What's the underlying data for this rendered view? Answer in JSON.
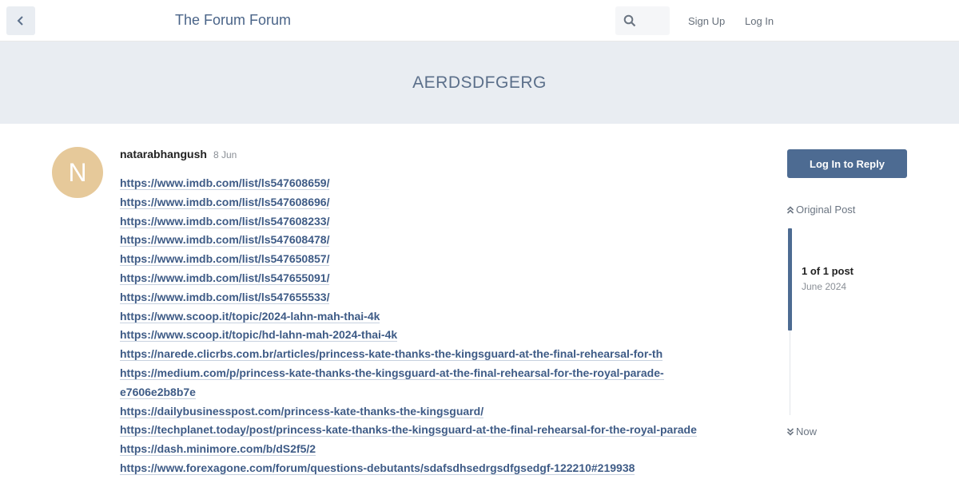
{
  "header": {
    "site_title": "The Forum Forum",
    "sign_up": "Sign Up",
    "log_in": "Log In",
    "back_icon": "chevron-left-icon",
    "search_icon": "search-icon"
  },
  "topic": {
    "title": "AERDSDFGERG"
  },
  "post": {
    "avatar_letter": "N",
    "avatar_color": "#e6c99a",
    "username": "natarabhangush",
    "date": "8 Jun",
    "links": [
      "https://www.imdb.com/list/ls547608659/",
      "https://www.imdb.com/list/ls547608696/",
      "https://www.imdb.com/list/ls547608233/",
      "https://www.imdb.com/list/ls547608478/",
      "https://www.imdb.com/list/ls547650857/",
      "https://www.imdb.com/list/ls547655091/",
      "https://www.imdb.com/list/ls547655533/",
      "https://www.scoop.it/topic/2024-lahn-mah-thai-4k",
      "https://www.scoop.it/topic/hd-lahn-mah-2024-thai-4k",
      "https://narede.clicrbs.com.br/articles/princess-kate-thanks-the-kingsguard-at-the-final-rehearsal-for-th",
      "https://medium.com/p/princess-kate-thanks-the-kingsguard-at-the-final-rehearsal-for-the-royal-parade-e7606e2b8b7e",
      "https://dailybusinesspost.com/princess-kate-thanks-the-kingsguard/",
      "https://techplanet.today/post/princess-kate-thanks-the-kingsguard-at-the-final-rehearsal-for-the-royal-parade",
      "https://dash.minimore.com/b/dS2f5/2",
      "https://www.forexagone.com/forum/questions-debutants/sdafsdhsedrgsdfgsedgf-122210#219938"
    ]
  },
  "sidebar": {
    "reply_button": "Log In to Reply",
    "original_post": "Original Post",
    "post_count": "1 of 1 post",
    "month": "June 2024",
    "now": "Now"
  },
  "colors": {
    "accent": "#4d6b92",
    "banner_bg": "#e9edf2",
    "link": "#3e5b86"
  }
}
